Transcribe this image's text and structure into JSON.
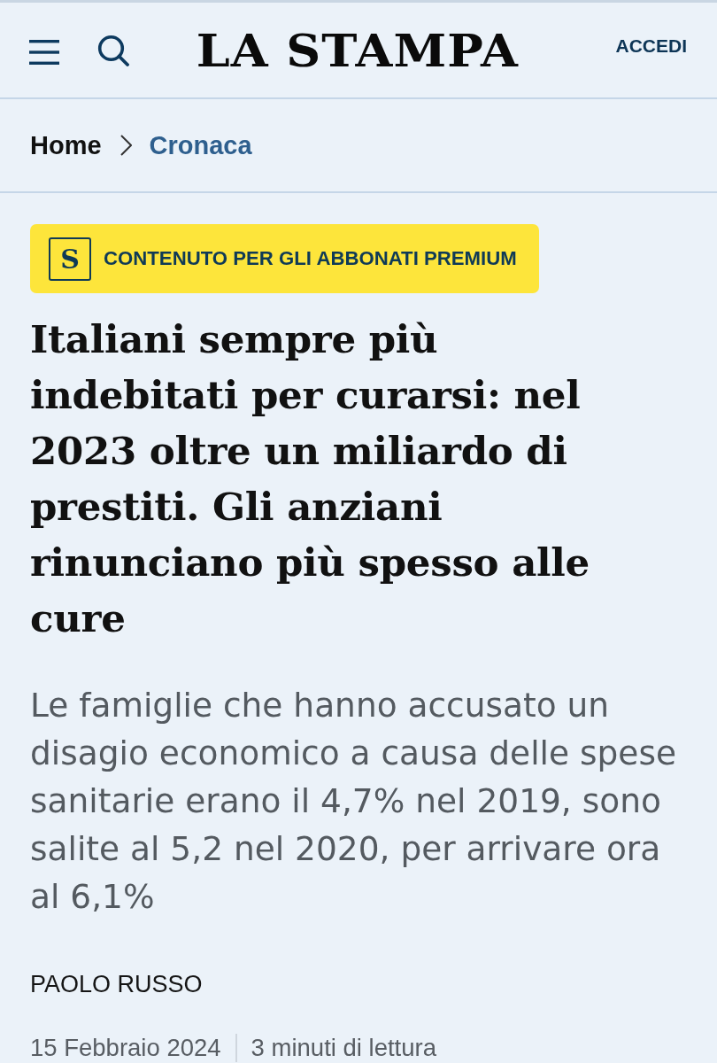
{
  "header": {
    "logo": "LA STAMPA",
    "login": "ACCEDI"
  },
  "breadcrumb": {
    "home": "Home",
    "section": "Cronaca"
  },
  "badge": {
    "letter": "S",
    "label": "CONTENUTO PER GLI ABBONATI PREMIUM"
  },
  "article": {
    "headline": "Italiani sempre più indebitati per curarsi: nel 2023 oltre un miliardo di prestiti. Gli anziani rinunciano più spesso alle cure",
    "summary": "Le famiglie che hanno accusato un disagio economico a causa delle spese sanitarie erano il 4,7% nel 2019, sono salite al 5,2 nel 2020, per arrivare ora al 6,1%",
    "author": "PAOLO RUSSO",
    "date": "15 Febbraio 2024",
    "reading_time": "3 minuti di lettura"
  }
}
